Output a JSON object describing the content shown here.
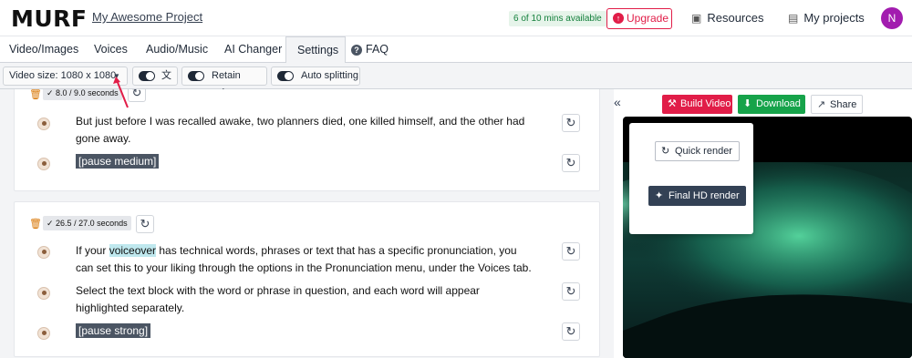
{
  "app": {
    "logo": "MURF",
    "project_name": "My Awesome Project",
    "minutes_badge": "6 of 10 mins available",
    "upgrade_label": "Upgrade",
    "resources_label": "Resources",
    "projects_label": "My projects",
    "avatar_initial": "N"
  },
  "tabs": [
    {
      "label": "Video/Images"
    },
    {
      "label": "Voices"
    },
    {
      "label": "Audio/Music"
    },
    {
      "label": "AI Changer"
    },
    {
      "label": "Settings",
      "active": true
    },
    {
      "label": "FAQ"
    }
  ],
  "toolbar": {
    "video_size": "Video size: 1080 x 1080",
    "retain_voice": "Retain voice",
    "auto_splitting": "Auto splitting"
  },
  "blocks": [
    {
      "duration": "8.0 / 9.0 seconds",
      "rows": [
        {
          "text": "But just before I was recalled awake, two planners died, one killed himself, and the other had gone away."
        },
        {
          "pause": "[pause medium]"
        }
      ]
    },
    {
      "duration": "26.5 / 27.0 seconds",
      "rows": [
        {
          "text_before": "If your ",
          "highlight": "voiceover",
          "text_after": " has technical words, phrases or text that has a specific pronunciation, you can set this to your liking through the options in the Pronunciation menu, under the Voices tab."
        },
        {
          "text": "Select the text block with the word or phrase in question, and each word will appear highlighted separately."
        },
        {
          "pause": "[pause strong]"
        }
      ]
    }
  ],
  "right": {
    "build_label": "Build Video",
    "download_label": "Download",
    "share_label": "Share",
    "quick_render_label": "Quick render",
    "final_render_label": "Final HD render"
  },
  "colors": {
    "accent_red": "#e11d48",
    "download_green": "#16a34a",
    "badge_green": "#15803d",
    "dark_slate": "#334155"
  }
}
